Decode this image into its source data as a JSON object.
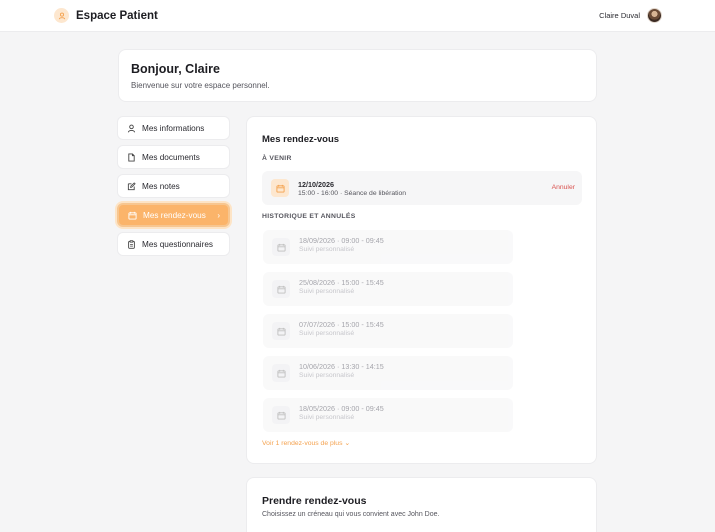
{
  "header": {
    "title": "Espace Patient",
    "user_name": "Claire Duval"
  },
  "welcome": {
    "title": "Bonjour, Claire",
    "subtitle": "Bienvenue sur votre espace personnel."
  },
  "nav": {
    "items": [
      {
        "label": "Mes informations",
        "icon": "user-icon"
      },
      {
        "label": "Mes documents",
        "icon": "file-icon"
      },
      {
        "label": "Mes notes",
        "icon": "edit-icon"
      },
      {
        "label": "Mes rendez-vous",
        "icon": "calendar-icon",
        "active": true
      },
      {
        "label": "Mes questionnaires",
        "icon": "clipboard-icon"
      }
    ]
  },
  "appointments": {
    "title": "Mes rendez-vous",
    "upcoming_label": "À VENIR",
    "upcoming": {
      "date": "12/10/2026",
      "details": "15:00 - 16:00 · Séance de libération",
      "cancel_label": "Annuler"
    },
    "history_label": "HISTORIQUE ET ANNULÉS",
    "history": [
      {
        "date": "18/09/2026 · 09:00 - 09:45",
        "type": "Suivi personnalisé"
      },
      {
        "date": "25/08/2026 · 15:00 - 15:45",
        "type": "Suivi personnalisé"
      },
      {
        "date": "07/07/2026 · 15:00 - 15:45",
        "type": "Suivi personnalisé"
      },
      {
        "date": "10/06/2026 · 13:30 - 14:15",
        "type": "Suivi personnalisé"
      },
      {
        "date": "18/05/2026 · 09:00 - 09:45",
        "type": "Suivi personnalisé"
      }
    ],
    "more_label": "Voir 1 rendez-vous de plus"
  },
  "booking": {
    "title": "Prendre rendez-vous",
    "subtitle": "Choisissez un créneau qui vous convient avec John Doe."
  },
  "colors": {
    "accent": "#fbb46a",
    "danger": "#d9534f"
  }
}
